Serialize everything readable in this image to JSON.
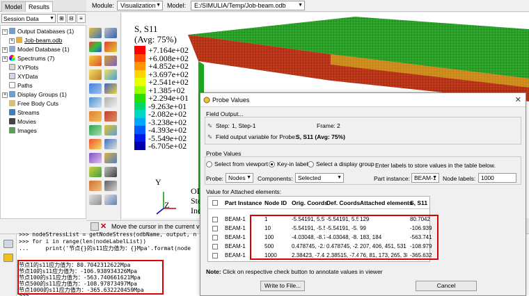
{
  "tabs": {
    "model": "Model",
    "results": "Results"
  },
  "session_select": "Session Data",
  "module_bar": {
    "module_label": "Module:",
    "module_value": "Visualization",
    "model_label": "Model:",
    "model_value": "E:/SIMULIA/Temp/Job-beam.odb"
  },
  "tree": {
    "items": [
      {
        "label": "Output Databases (1)"
      },
      {
        "label": "Job-beam.odb"
      },
      {
        "label": "Model Database (1)"
      },
      {
        "label": "Spectrums (7)"
      },
      {
        "label": "XYPlots"
      },
      {
        "label": "XYData"
      },
      {
        "label": "Paths"
      },
      {
        "label": "Display Groups (1)"
      },
      {
        "label": "Free Body Cuts"
      },
      {
        "label": "Streams"
      },
      {
        "label": "Movies"
      },
      {
        "label": "Images"
      }
    ]
  },
  "legend": {
    "title": "S, S11",
    "subtitle": "(Avg: 75%)",
    "values": [
      "+7.164e+02",
      "+6.008e+02",
      "+4.852e+02",
      "+3.697e+02",
      "+2.541e+02",
      "+1.385+02",
      "+2.294e+01",
      "-9.263e+01",
      "-2.082e+02",
      "-3.238e+02",
      "-4.393e+02",
      "-5.549e+02",
      "-6.705e+02"
    ],
    "colors": [
      "#ff0000",
      "#ff4a00",
      "#ff9500",
      "#ffd500",
      "#eaff00",
      "#9cff00",
      "#28e000",
      "#00d86a",
      "#00d7c0",
      "#00a6ff",
      "#0058ff",
      "#0018e8",
      "#0000b0"
    ]
  },
  "viewport": {
    "triad_y": "Y",
    "triad_z": "Z",
    "odb_lines": [
      "OD",
      "Ste",
      "Inc"
    ]
  },
  "prompt": {
    "text": "Move the cursor in the current view"
  },
  "console": {
    "lines": [
      ">>> nodeStressList = getNodeStress(odbName, output, n",
      ">>> for i in range(len(nodeLabelList))",
      "...     print('节点{}的s11应力值为：{}Mpa'.format(node",
      "节点1的s11应力值为：80.7042312622Mpa",
      "节点10的s11应力值为：-106.938934326Mpa",
      "节点100的s11应力值为：-563.740661621Mpa",
      "节点500的s11应力值为：-108.97873497Mpa",
      "节点1000的s11应力值为：-365.632220459Mpa",
      ">>>"
    ]
  },
  "dialog": {
    "title": "Probe Values",
    "field_output_label": "Field Output...",
    "step_label": "Step:",
    "step_value": "1, Step-1",
    "frame_label": "Frame:",
    "frame_value": "2",
    "field_var_label": "Field output variable for Probe:",
    "field_var_value": "S, S11 (Avg: 75%)",
    "probe_values_label": "Probe Values",
    "radio_viewport": "Select from viewport",
    "radio_keyin": "Key-in label",
    "radio_display_group": "Select a display group",
    "probe_label": "Probe:",
    "probe_value": "Nodes",
    "components_label": "Components:",
    "components_value": "Selected",
    "enter_labels_text": "Enter labels to store values in the table below.",
    "part_instance_label": "Part instance:",
    "part_instance_value": "BEAM-1",
    "node_labels_label": "Node labels:",
    "node_labels_value": "1000",
    "value_for_label": "Value for Attached elements:",
    "columns": [
      "Part Instance",
      "Node ID",
      "Orig. Coords",
      "Def. Coords",
      "Attached elements",
      "S, S11"
    ],
    "rows": [
      [
        "BEAM-1",
        "1",
        "-5.54191, 5.57",
        "-5.54191, 5.5",
        "129",
        "80.7042"
      ],
      [
        "BEAM-1",
        "10",
        "-5.54191, -5.5",
        "-5.54191, -5.",
        "99",
        "-106.939"
      ],
      [
        "BEAM-1",
        "100",
        "-4.03048, -8.7",
        "-4.03048, -8.",
        "183, 184",
        "-563.741"
      ],
      [
        "BEAM-1",
        "500",
        "0.478745, -2.5",
        "0.478745, -2.",
        "207, 406, 451, 531",
        "-108.979"
      ],
      [
        "BEAM-1",
        "1000",
        "2.38423, -7.41",
        "2.38515, -7.4",
        "76, 81, 173, 265, 38",
        "-365.632"
      ]
    ],
    "note_label": "Note:",
    "note_text": "Click on respective check button to annotate values in viewer",
    "write_button": "Write to File...",
    "cancel_button": "Cancel"
  }
}
